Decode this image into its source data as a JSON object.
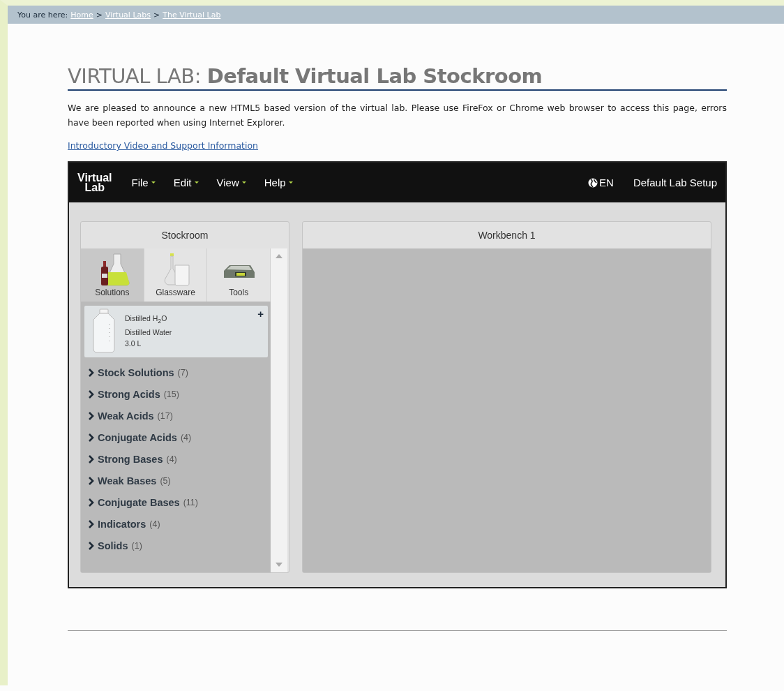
{
  "breadcrumb": {
    "label": "You are here:",
    "links": [
      "Home",
      "Virtual Labs",
      "The Virtual Lab"
    ],
    "separator": ">"
  },
  "heading": "VIRTUAL LAB: **Default Virtual Lab Stockroom**",
  "intro": "We are pleased to announce a new HTML5 based version of the virtual lab. Please use FireFox or Chrome web browser to access this page, errors have been reported when using Internet Explorer.",
  "support_link": "Introductory Video and Support Information",
  "app": {
    "logo": [
      "Virtual",
      "Lab"
    ],
    "menus": [
      "File",
      "Edit",
      "View",
      "Help"
    ],
    "language": "EN",
    "setup": "Default Lab Setup",
    "stockroom": {
      "title": "Stockroom",
      "tabs": [
        {
          "label": "Solutions",
          "kind": "solutions",
          "selected": true
        },
        {
          "label": "Glassware",
          "kind": "glassware",
          "selected": false
        },
        {
          "label": "Tools",
          "kind": "tools",
          "selected": false
        }
      ],
      "featured": {
        "name": "Distilled H$_{2}$O",
        "description": "Distilled Water",
        "volume": "3.0 L",
        "action": "+"
      },
      "categories": [
        {
          "name": "Stock Solutions",
          "count": "(7)",
          "expanded": false
        },
        {
          "name": "Strong Acids",
          "count": "(15)",
          "expanded": false
        },
        {
          "name": "Weak Acids",
          "count": "(17)",
          "expanded": false
        },
        {
          "name": "Conjugate Acids",
          "count": "(4)",
          "expanded": false
        },
        {
          "name": "Strong Bases",
          "count": "(4)",
          "expanded": false
        },
        {
          "name": "Weak Bases",
          "count": "(5)",
          "expanded": false
        },
        {
          "name": "Conjugate Bases",
          "count": "(11)",
          "expanded": false
        },
        {
          "name": "Indicators",
          "count": "(4)",
          "expanded": false
        },
        {
          "name": "Solids",
          "count": "(1)",
          "expanded": false
        }
      ]
    },
    "workbench": {
      "title": "Workbench 1"
    }
  }
}
